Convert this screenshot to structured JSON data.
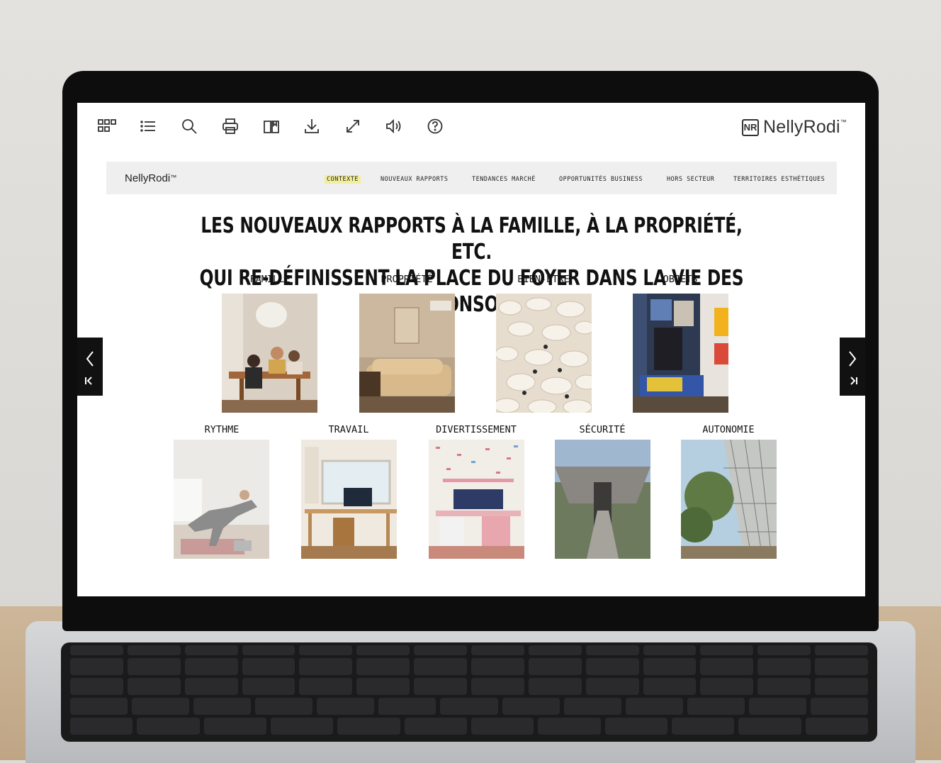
{
  "toolbar": {
    "icons": [
      "grid-icon",
      "list-icon",
      "search-icon",
      "print-icon",
      "book-icon",
      "download-icon",
      "fullscreen-icon",
      "sound-icon",
      "help-icon"
    ],
    "brand": "NellyRodi",
    "brand_tm": "™",
    "brand_mark": "NR"
  },
  "document": {
    "brand": "NellyRodi",
    "brand_tm": "™",
    "nav": [
      {
        "label": "CONTEXTE",
        "active": true
      },
      {
        "label": "NOUVEAUX RAPPORTS",
        "active": false
      },
      {
        "label": "TENDANCES MARCHÉ",
        "active": false
      },
      {
        "label": "OPPORTUNITÉS BUSINESS",
        "active": false
      },
      {
        "label": "HORS SECTEUR",
        "active": false
      },
      {
        "label": "TERRITOIRES ESTHÉTIQUES",
        "active": false
      }
    ],
    "title_line1": "LES NOUVEAUX RAPPORTS À LA FAMILLE, À LA PROPRIÉTÉ, ETC.",
    "title_line2": "QUI RE-DÉFINISSENT LA PLACE DU FOYER DANS LA VIE DES CONSOS",
    "categories": [
      {
        "label": "FAMILLE"
      },
      {
        "label": "PROPRIÉTÉ"
      },
      {
        "label": "BIEN-ÊTRE"
      },
      {
        "label": "OBJETS"
      },
      {
        "label": "RYTHME"
      },
      {
        "label": "TRAVAIL"
      },
      {
        "label": "DIVERTISSEMENT"
      },
      {
        "label": "SÉCURITÉ"
      },
      {
        "label": "AUTONOMIE"
      }
    ]
  },
  "colors": {
    "highlight": "#f2ef9c",
    "screen_bg": "#ffffff",
    "doc_header_bg": "#efefef",
    "bezel": "#0d0d0e"
  }
}
